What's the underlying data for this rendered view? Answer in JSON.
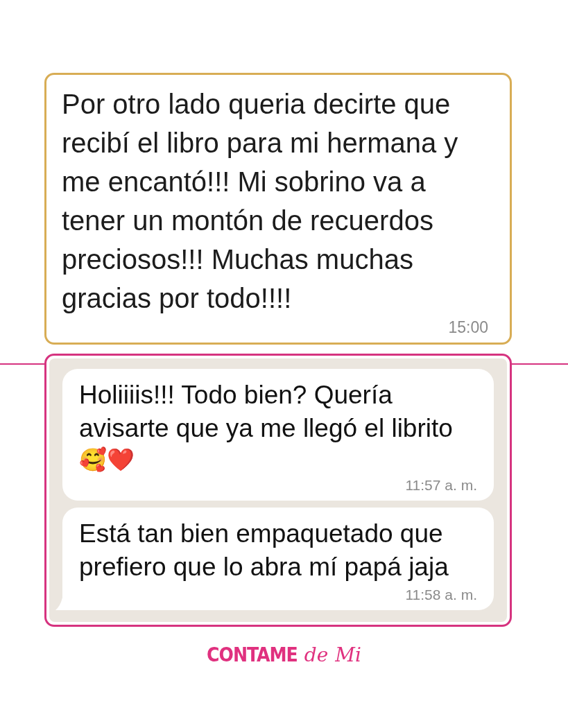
{
  "top_message": {
    "text": "Por otro lado queria decirte que recibí el libro para mi hermana y me encantó!!! Mi sobrino va a tener un montón de recuerdos preciosos!!! Muchas muchas gracias por todo!!!!",
    "time": "15:00"
  },
  "chat": {
    "messages": [
      {
        "text": "Holiiiis!!! Todo bien? Quería avisarte que ya me llegó el librito",
        "emoji": "🥰❤️",
        "time": "11:57 a. m.",
        "tail": false
      },
      {
        "text": "Está tan bien empaquetado que prefiero que lo abra mí papá jaja",
        "time": "11:58 a. m.",
        "tail": true
      }
    ]
  },
  "logo": {
    "words": [
      {
        "text": "CONTAME",
        "kind": "block"
      },
      {
        "text": "de",
        "kind": "script"
      },
      {
        "text": "Mi",
        "kind": "script"
      }
    ]
  }
}
